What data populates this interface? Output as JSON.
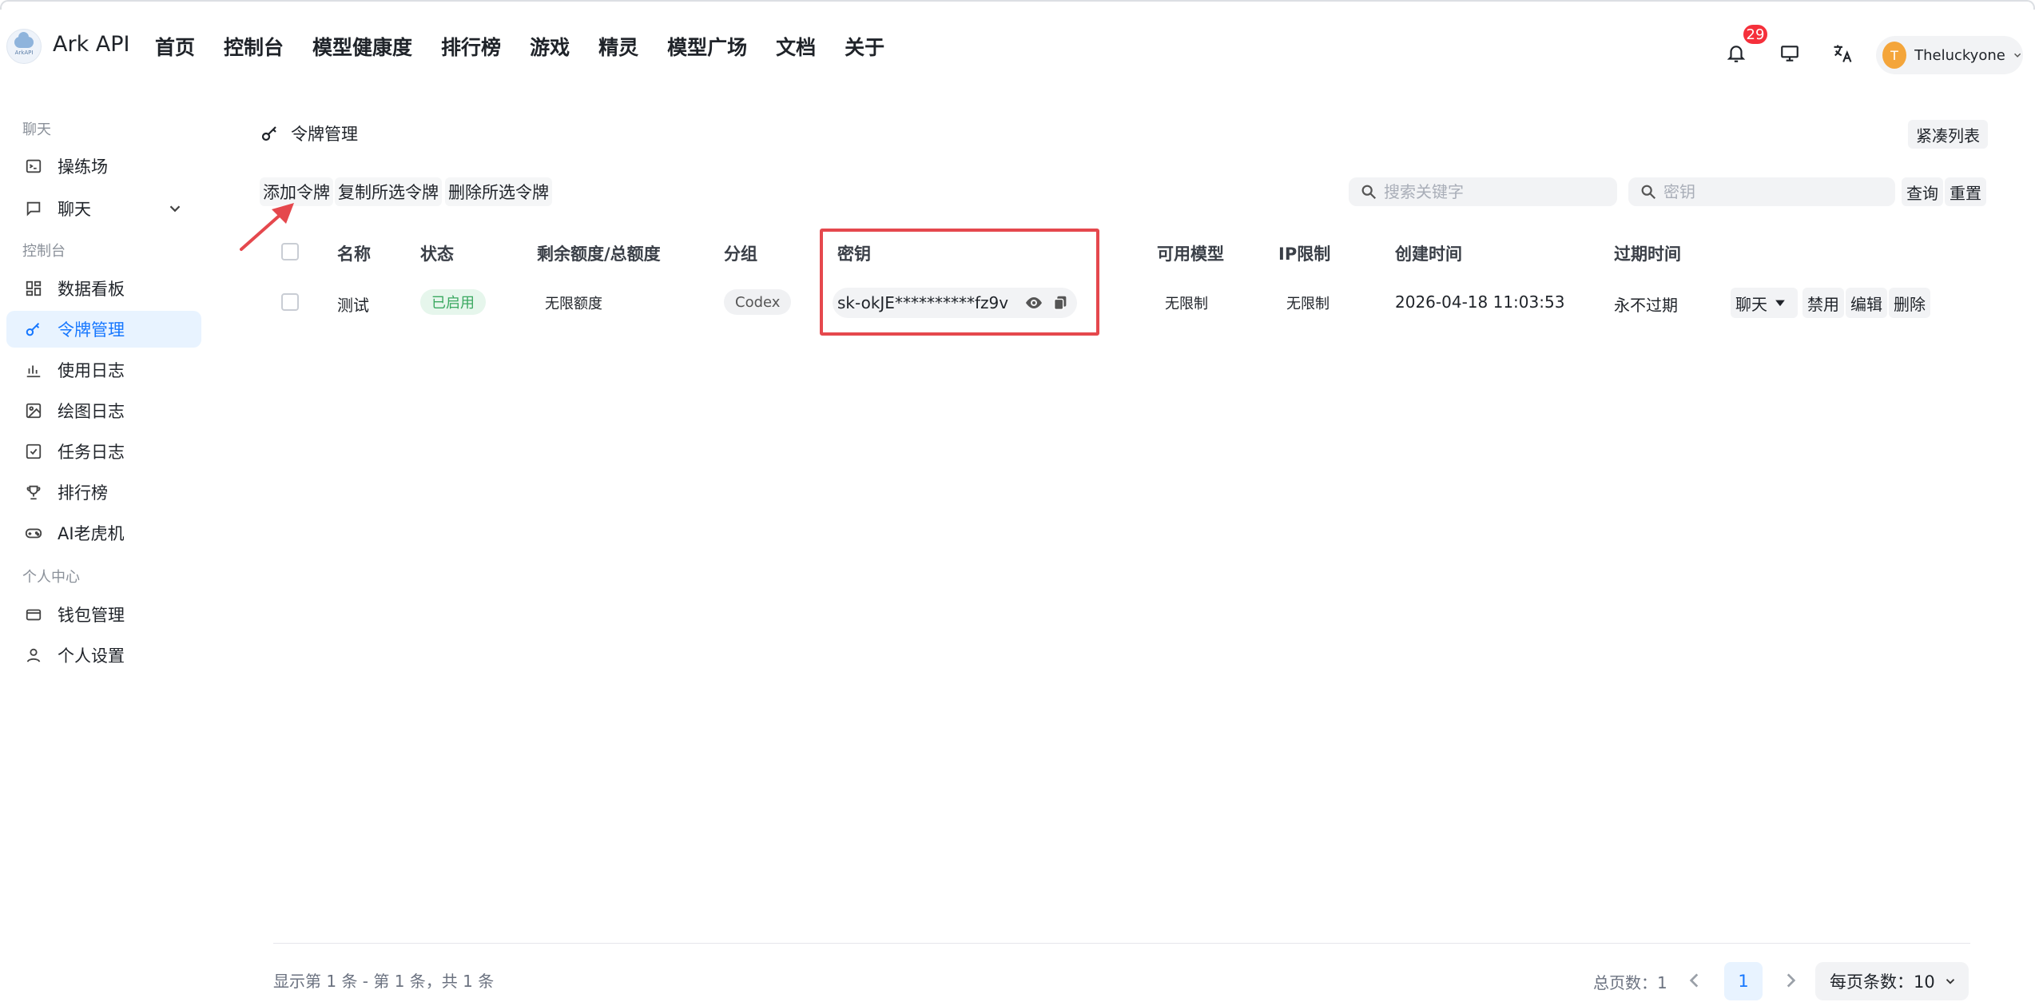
{
  "header": {
    "brand": "Ark API",
    "logo_text": "ArkAPI",
    "nav": [
      "首页",
      "控制台",
      "模型健康度",
      "排行榜",
      "游戏",
      "精灵",
      "模型广场",
      "文档",
      "关于"
    ],
    "notification_count": "29",
    "user": {
      "initial": "T",
      "name": "Theluckyone"
    }
  },
  "sidebar": {
    "sections": [
      "聊天",
      "控制台",
      "个人中心"
    ],
    "items": [
      "操练场",
      "聊天",
      "数据看板",
      "令牌管理",
      "使用日志",
      "绘图日志",
      "任务日志",
      "排行榜",
      "AI老虎机",
      "钱包管理",
      "个人设置"
    ],
    "active": "令牌管理"
  },
  "page": {
    "title": "令牌管理",
    "compact_label": "紧凑列表",
    "actions": {
      "add": "添加令牌",
      "copy": "复制所选令牌",
      "delete": "删除所选令牌"
    },
    "search": {
      "keyword_placeholder": "搜索关键字",
      "key_placeholder": "密钥",
      "query": "查询",
      "reset": "重置"
    }
  },
  "table": {
    "columns": [
      "名称",
      "状态",
      "剩余额度/总额度",
      "分组",
      "密钥",
      "可用模型",
      "IP限制",
      "创建时间",
      "过期时间"
    ],
    "rows": [
      {
        "name": "测试",
        "status": "已启用",
        "quota": "无限额度",
        "group": "Codex",
        "key": "sk-okJE**********fz9v",
        "models": "无限制",
        "ip": "无限制",
        "created": "2026-04-18 11:03:53",
        "expires": "永不过期",
        "actions": [
          "聊天",
          "禁用",
          "编辑",
          "删除"
        ]
      }
    ]
  },
  "footer": {
    "summary": "显示第 1 条 - 第 1 条，共 1 条",
    "total_pages": "总页数：1",
    "current_page": "1",
    "per_page": "每页条数：10"
  },
  "colors": {
    "accent": "#1677ff",
    "highlight_box": "#e5484d",
    "badge": "#f5303b",
    "status_green": "#3aa860"
  }
}
